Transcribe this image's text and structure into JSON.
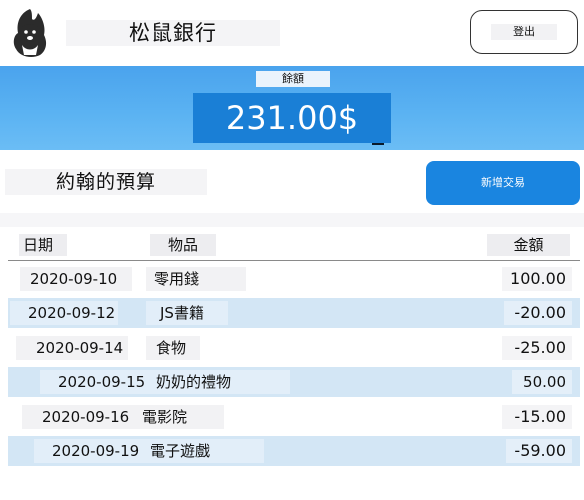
{
  "header": {
    "bank_name": "松鼠銀行",
    "logout_label": "登出"
  },
  "balance": {
    "label": "餘額",
    "amount": "231.00$"
  },
  "budget": {
    "title": "約翰的預算",
    "add_button_label": "新增交易"
  },
  "table": {
    "headers": {
      "date": "日期",
      "item": "物品",
      "amount": "金額"
    },
    "rows": [
      {
        "date": "2020-09-10",
        "item": "零用錢",
        "amount": "100.00"
      },
      {
        "date": "2020-09-12",
        "item": "JS書籍",
        "amount": "-20.00"
      },
      {
        "date": "2020-09-14",
        "item": "食物",
        "amount": "-25.00"
      },
      {
        "date": "2020-09-15",
        "item": "奶奶的禮物",
        "amount": "50.00"
      },
      {
        "date": "2020-09-16",
        "item": "電影院",
        "amount": "-15.00"
      },
      {
        "date": "2020-09-19",
        "item": "電子遊戲",
        "amount": "-59.00"
      }
    ]
  },
  "colors": {
    "accent": "#1a85e0",
    "balance_band": "#5ab2f2",
    "row_alt": "#d3e6f5"
  },
  "icons": {
    "logo": "squirrel-icon"
  }
}
